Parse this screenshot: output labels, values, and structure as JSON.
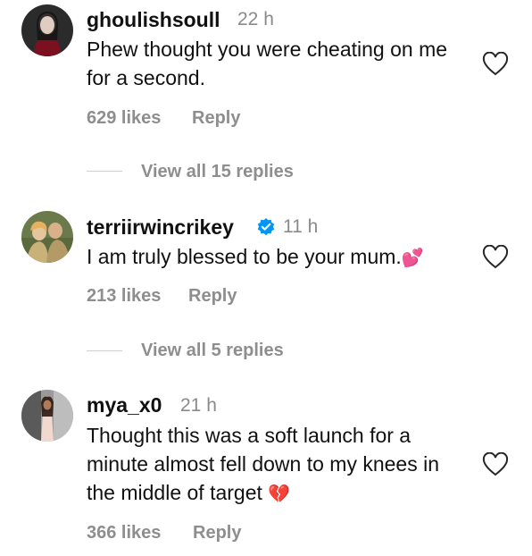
{
  "comments": [
    {
      "username": "ghoulishsoull",
      "time": "22 h",
      "text": "Phew thought you were cheating on me for a second.",
      "likes": "629 likes",
      "reply_label": "Reply",
      "view_replies": "View all 15 replies",
      "verified": false
    },
    {
      "username": "terriirwincrikey",
      "time": "11 h",
      "text": "I am truly blessed to be your mum.",
      "text_emoji": "💕",
      "likes": "213 likes",
      "reply_label": "Reply",
      "view_replies": "View all 5 replies",
      "verified": true
    },
    {
      "username": "mya_x0",
      "time": "21 h",
      "text": "Thought this was a soft launch for a minute almost fell down to my knees in the middle of target",
      "text_emoji": "💔",
      "likes": "366 likes",
      "reply_label": "Reply",
      "verified": false
    }
  ],
  "colors": {
    "verified_blue": "#0095f6",
    "muted_text": "#8e8e8e"
  },
  "icons": {
    "like": "heart-outline-icon",
    "verified": "verified-badge-icon"
  }
}
